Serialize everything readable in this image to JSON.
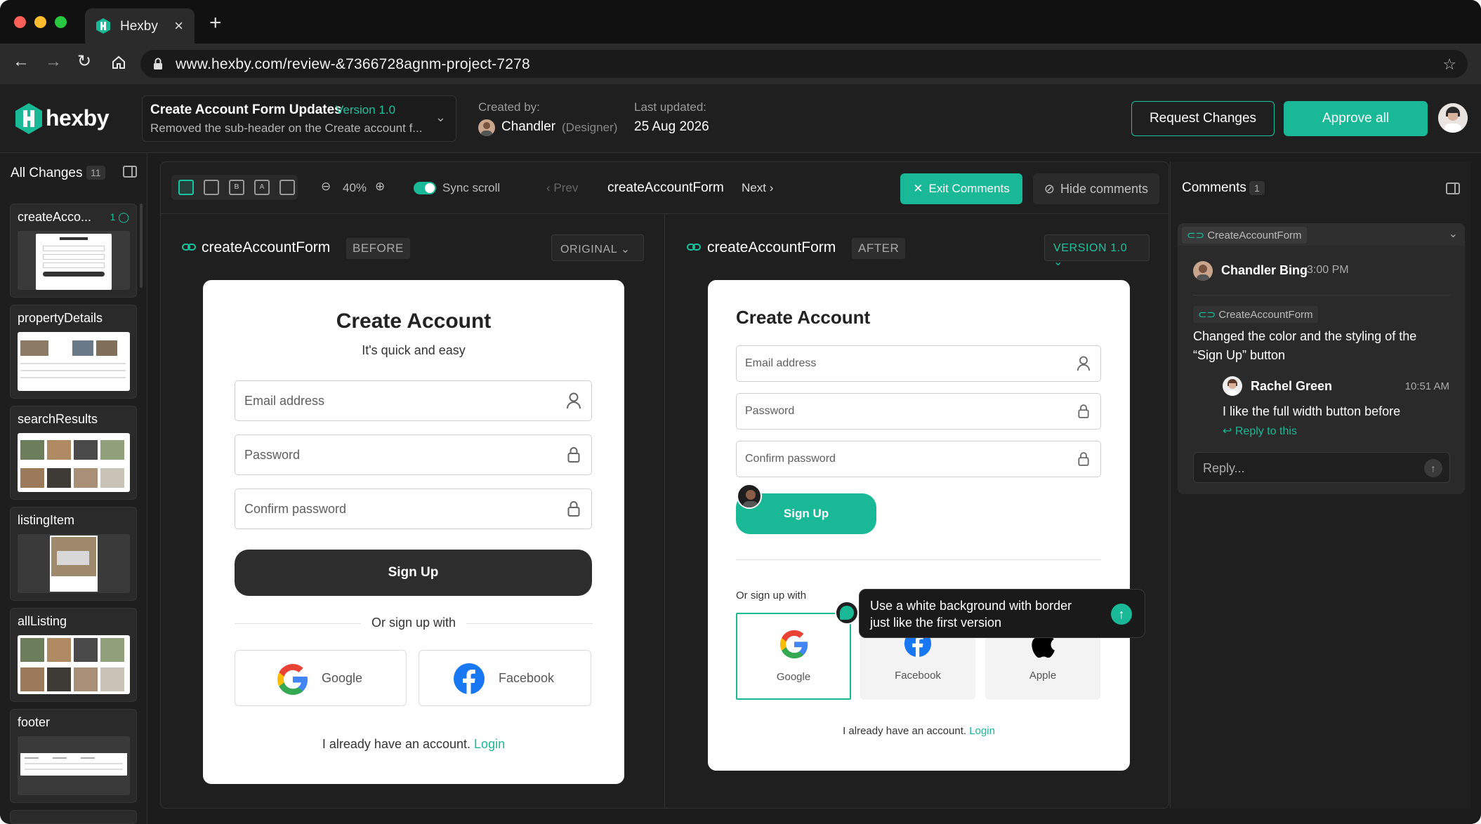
{
  "browser": {
    "tab_title": "Hexby",
    "url": "www.hexby.com/review-&7366728agnm-project-7278"
  },
  "header": {
    "logo_text": "hexby",
    "project_title": "Create Account Form Updates",
    "project_version": "Version 1.0",
    "project_summary": "Removed the sub-header on the Create account f...",
    "created_by_label": "Created by:",
    "created_by_name": "Chandler",
    "created_by_role": "(Designer)",
    "updated_label": "Last updated:",
    "updated_value": "25 Aug 2026",
    "request_changes": "Request Changes",
    "approve_all": "Approve all"
  },
  "sidebar": {
    "title": "All Changes",
    "count": "11",
    "items": [
      {
        "label": "createAcco...",
        "comments": "1"
      },
      {
        "label": "propertyDetails"
      },
      {
        "label": "searchResults"
      },
      {
        "label": "listingItem"
      },
      {
        "label": "allListing"
      },
      {
        "label": "footer"
      }
    ]
  },
  "toolbar": {
    "view_modes": [
      "B",
      "A"
    ],
    "zoom": "40%",
    "sync_scroll": "Sync scroll",
    "prev": "Prev",
    "current": "createAccountForm",
    "next": "Next",
    "exit_comments": "Exit Comments",
    "hide_comments": "Hide comments"
  },
  "before": {
    "name": "createAccountForm",
    "tag": "BEFORE",
    "select": "ORIGINAL",
    "card": {
      "title": "Create Account",
      "subtitle": "It's quick and easy",
      "email": "Email address",
      "password": "Password",
      "confirm": "Confirm password",
      "signup": "Sign Up",
      "or": "Or sign up with",
      "google": "Google",
      "facebook": "Facebook",
      "have_account": "I already have an account.",
      "login": "Login"
    }
  },
  "after": {
    "name": "createAccountForm",
    "tag": "AFTER",
    "select": "VERSION 1.0",
    "card": {
      "title": "Create Account",
      "email": "Email address",
      "password": "Password",
      "confirm": "Confirm password",
      "signup": "Sign Up",
      "or": "Or sign up with",
      "google": "Google",
      "facebook": "Facebook",
      "apple": "Apple",
      "have_account": "I already have an account.",
      "login": "Login"
    },
    "inline_comment": "Use a white background with border just like the first version"
  },
  "comments": {
    "title": "Comments",
    "count": "1",
    "thread_tag": "CreateAccountForm",
    "first": {
      "author": "Chandler Bing",
      "time": "3:00 PM",
      "tag": "CreateAccountForm",
      "text": "Changed the color and the styling of the “Sign Up” button"
    },
    "reply": {
      "author": "Rachel Green",
      "time": "10:51 AM",
      "text": "I like the full width button before",
      "reply_link": "Reply to this"
    },
    "reply_placeholder": "Reply..."
  },
  "colors": {
    "accent": "#19b896",
    "background": "#1c1c1c",
    "dark_button": "#2d2d2d"
  }
}
